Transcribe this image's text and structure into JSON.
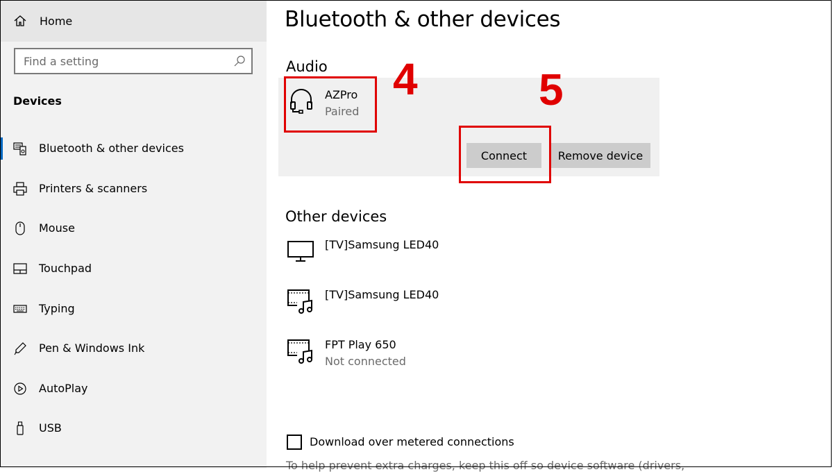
{
  "sidebar": {
    "home_label": "Home",
    "search_placeholder": "Find a setting",
    "section_title": "Devices",
    "items": [
      {
        "label": "Bluetooth & other devices",
        "icon": "bluetooth-devices-icon"
      },
      {
        "label": "Printers & scanners",
        "icon": "printer-icon"
      },
      {
        "label": "Mouse",
        "icon": "mouse-icon"
      },
      {
        "label": "Touchpad",
        "icon": "touchpad-icon"
      },
      {
        "label": "Typing",
        "icon": "keyboard-icon"
      },
      {
        "label": "Pen & Windows Ink",
        "icon": "pen-icon"
      },
      {
        "label": "AutoPlay",
        "icon": "autoplay-icon"
      },
      {
        "label": "USB",
        "icon": "usb-icon"
      }
    ]
  },
  "main": {
    "title": "Bluetooth & other devices",
    "audio": {
      "heading": "Audio",
      "device": {
        "name": "AZPro",
        "status": "Paired",
        "icon": "headset-icon"
      },
      "connect_label": "Connect",
      "remove_label": "Remove device"
    },
    "other": {
      "heading": "Other devices",
      "devices": [
        {
          "name": "[TV]Samsung LED40",
          "status": "",
          "icon": "monitor-icon"
        },
        {
          "name": "[TV]Samsung LED40",
          "status": "",
          "icon": "media-device-icon"
        },
        {
          "name": "FPT Play 650",
          "status": "Not connected",
          "icon": "media-device-icon"
        }
      ]
    },
    "metered_label": "Download over metered connections",
    "help_text": "To help prevent extra charges, keep this off so device software (drivers,"
  },
  "annotations": {
    "step4": "4",
    "step5": "5",
    "highlight_color": "#e00000"
  },
  "colors": {
    "sidebar_bg": "#f2f2f2",
    "accent": "#0067c0",
    "button_bg": "#cccccc"
  }
}
